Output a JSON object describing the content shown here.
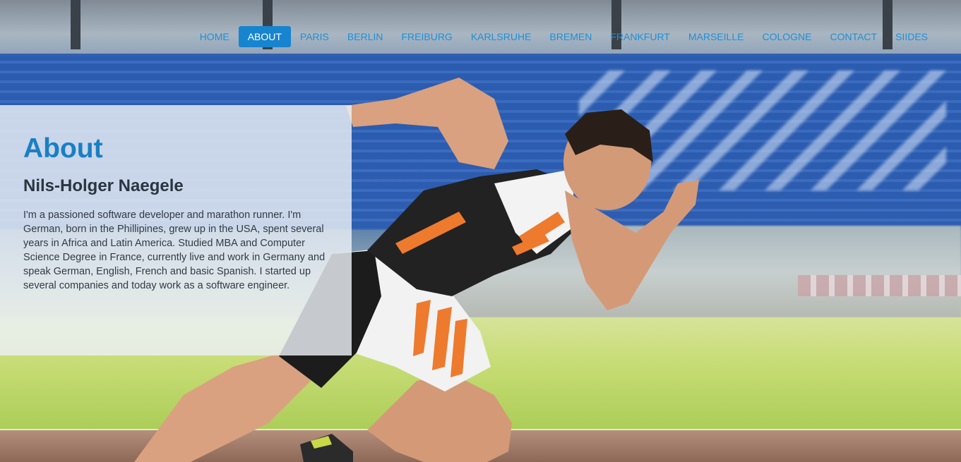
{
  "nav": {
    "items": [
      {
        "label": "HOME",
        "active": false
      },
      {
        "label": "ABOUT",
        "active": true
      },
      {
        "label": "PARIS",
        "active": false
      },
      {
        "label": "BERLIN",
        "active": false
      },
      {
        "label": "FREIBURG",
        "active": false
      },
      {
        "label": "KARLSRUHE",
        "active": false
      },
      {
        "label": "BREMEN",
        "active": false
      },
      {
        "label": "FRANKFURT",
        "active": false
      },
      {
        "label": "MARSEILLE",
        "active": false
      },
      {
        "label": "COLOGNE",
        "active": false
      },
      {
        "label": "CONTACT",
        "active": false
      },
      {
        "label": "SIIDES",
        "active": false
      }
    ],
    "link_color": "#1f8fd6",
    "active_bg": "#1784cf"
  },
  "about": {
    "title": "About",
    "name": "Nils-Holger Naegele",
    "bio": "I'm a passioned software developer and marathon runner. I'm German, born in the Phillipines, grew up in the USA, spent several years in Africa and Latin America. Studied MBA and Computer Science Degree in France, currently live and work in Germany and speak German, English, French and basic Spanish. I started up several companies and today work as a software engineer."
  },
  "colors": {
    "accent": "#1a7fc4",
    "heading": "#2a3540"
  }
}
